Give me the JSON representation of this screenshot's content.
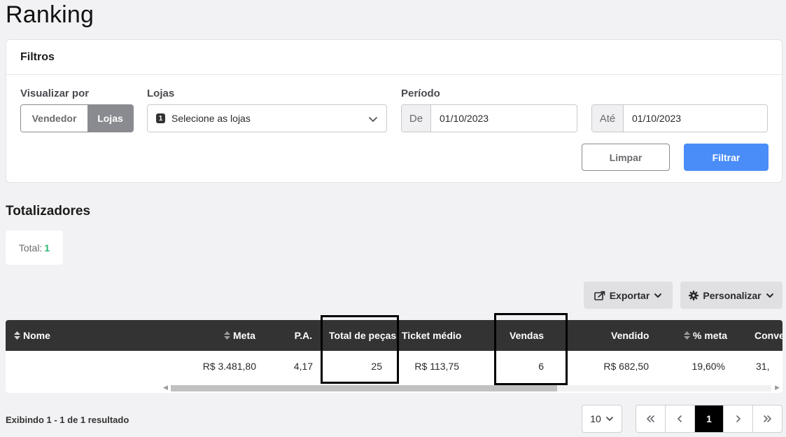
{
  "page": {
    "title": "Ranking"
  },
  "filters": {
    "title": "Filtros",
    "view_by": {
      "label": "Visualizar por",
      "options": [
        "Vendedor",
        "Lojas"
      ],
      "selected": "Lojas"
    },
    "stores": {
      "label": "Lojas",
      "count_badge": "1",
      "placeholder": "Selecione as lojas"
    },
    "period": {
      "label": "Período",
      "from_prefix": "De",
      "from_value": "01/10/2023",
      "to_prefix": "Até",
      "to_value": "01/10/2023"
    },
    "clear_label": "Limpar",
    "filter_label": "Filtrar"
  },
  "totals": {
    "title": "Totalizadores",
    "label": "Total:",
    "value": "1"
  },
  "toolbar": {
    "export_label": "Exportar",
    "customize_label": "Personalizar"
  },
  "table": {
    "headers": {
      "nome": "Nome",
      "meta": "Meta",
      "pa": "P.A.",
      "total_pecas": "Total de peças",
      "ticket_medio": "Ticket médio",
      "vendas": "Vendas",
      "vendido": "Vendido",
      "pct_meta": "% meta",
      "conversao": "Conve"
    },
    "rows": [
      {
        "nome": "",
        "meta": "R$ 3.481,80",
        "pa": "4,17",
        "total_pecas": "25",
        "ticket_medio": "R$ 113,75",
        "vendas": "6",
        "vendido": "R$ 682,50",
        "pct_meta": "19,60%",
        "conversao": "31,"
      }
    ]
  },
  "footer": {
    "result_info": "Exibindo 1 - 1 de 1 resultado",
    "page_size": "10",
    "current_page": "1"
  },
  "colors": {
    "accent": "#4a8df8",
    "header_bg": "#333334",
    "total_value": "#2bb673"
  }
}
